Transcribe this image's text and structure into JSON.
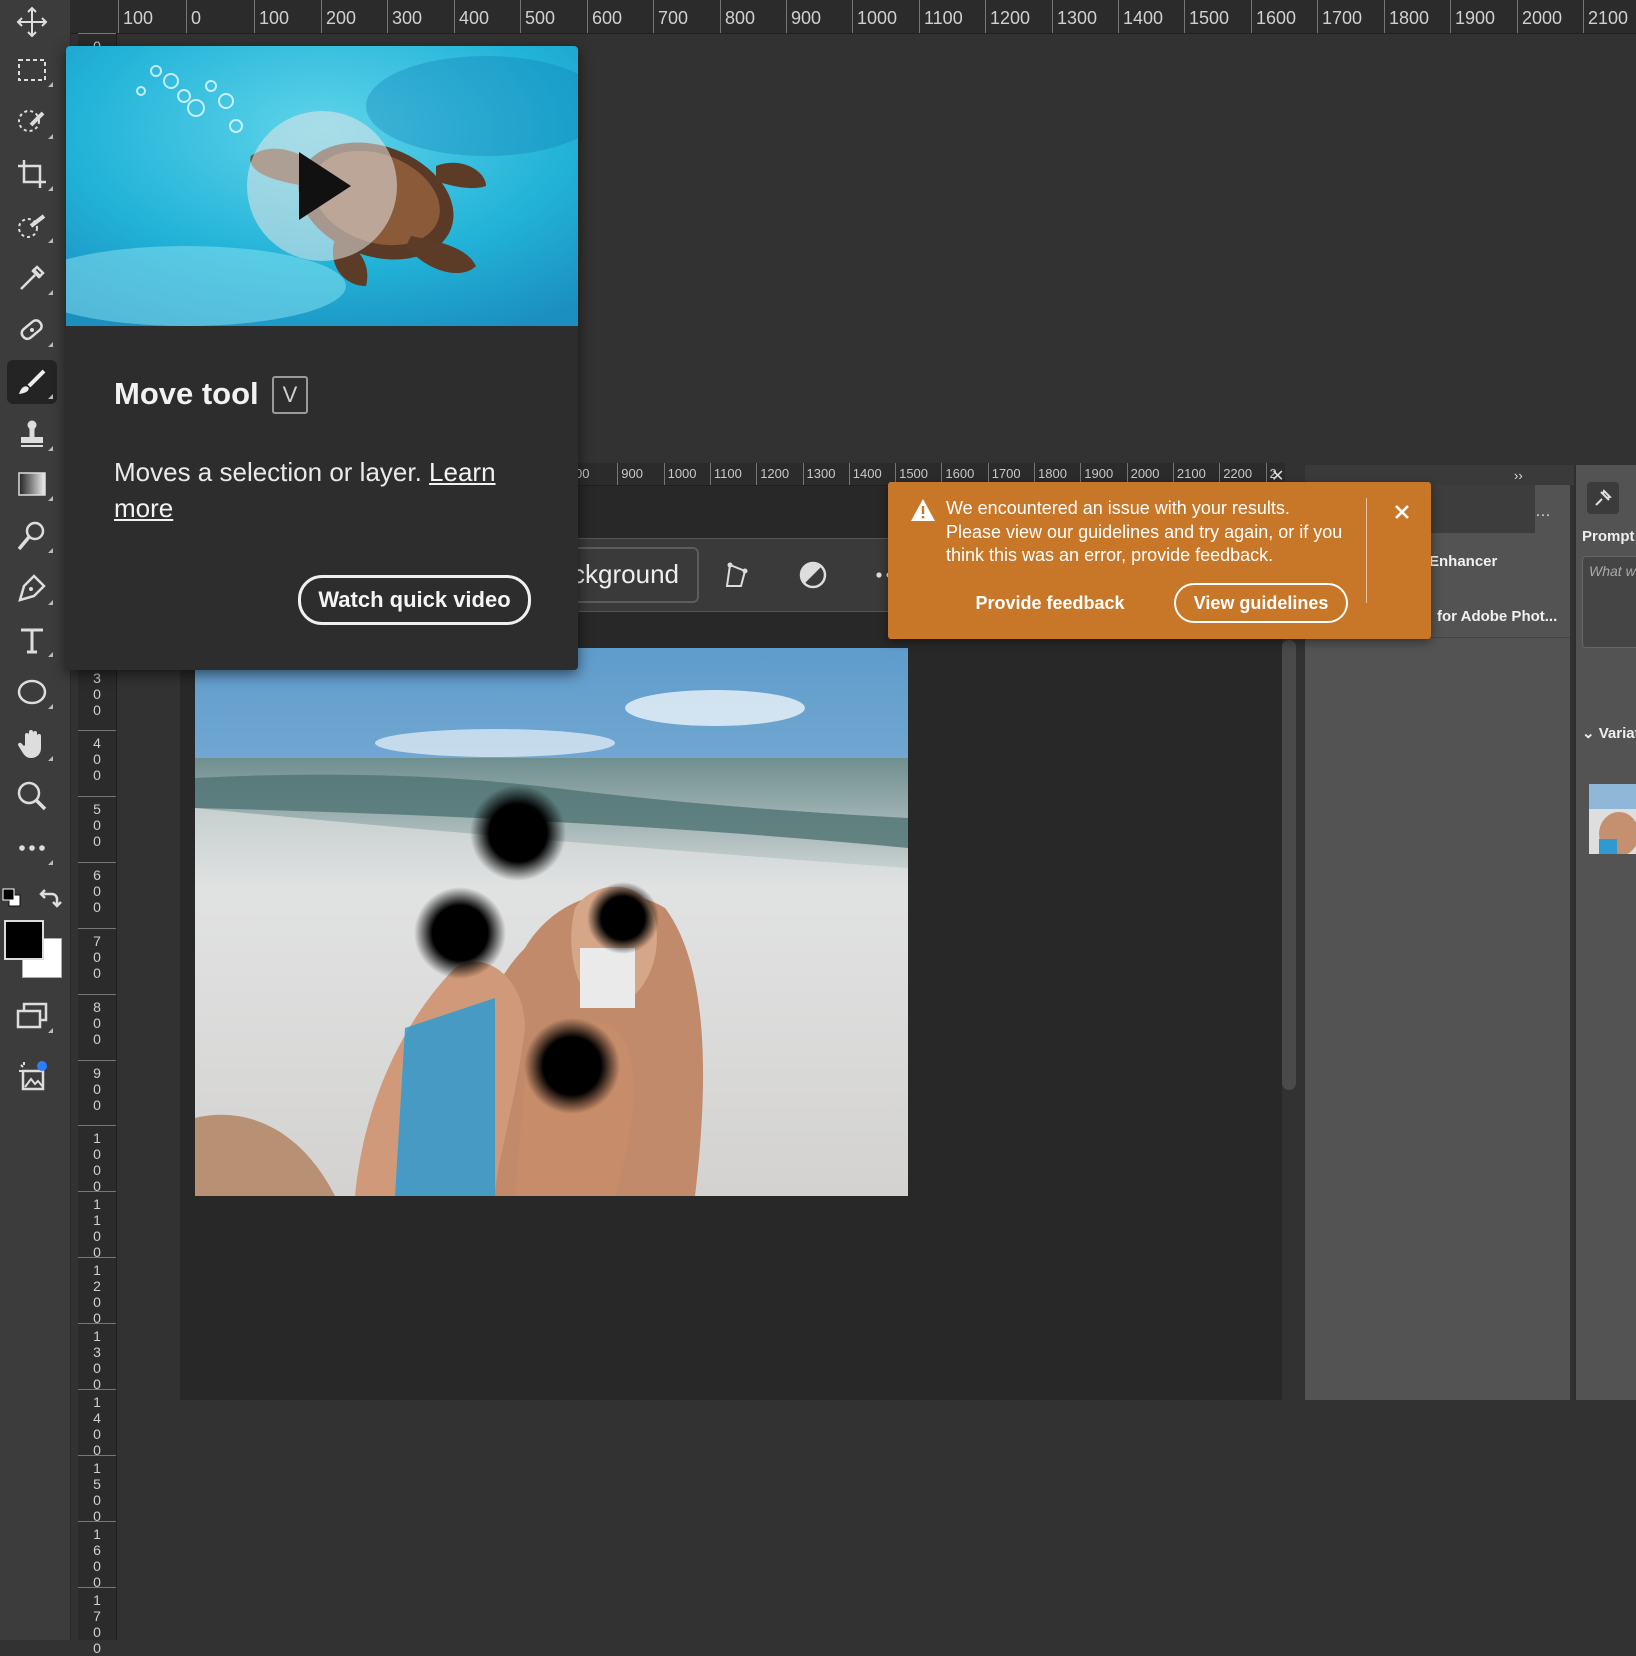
{
  "rulers": {
    "top": [
      "100",
      "0",
      "100",
      "200",
      "300",
      "400",
      "500",
      "600",
      "700",
      "800",
      "900",
      "1000",
      "1100",
      "1200",
      "1300",
      "1400",
      "1500",
      "1600",
      "1700",
      "1800",
      "1900",
      "2000",
      "2100"
    ],
    "left": [
      "0",
      "300",
      "400",
      "500",
      "600",
      "700",
      "800",
      "900",
      "1000",
      "1100",
      "1200",
      "1300",
      "1400",
      "1500",
      "1600",
      "1700"
    ],
    "document": [
      "00",
      "900",
      "1000",
      "1100",
      "1200",
      "1300",
      "1400",
      "1500",
      "1600",
      "1700",
      "1800",
      "1900",
      "2000",
      "2100",
      "2200",
      "2"
    ]
  },
  "toolbar": {
    "tools": [
      {
        "name": "move-tool",
        "icon": "move-icon",
        "active": false
      },
      {
        "name": "marquee-tool",
        "icon": "rectangle-marquee-icon",
        "active": false
      },
      {
        "name": "quick-selection-tool",
        "icon": "quick-selection-icon",
        "active": false
      },
      {
        "name": "crop-tool",
        "icon": "crop-icon",
        "active": false
      },
      {
        "name": "object-selection-tool",
        "icon": "object-selection-icon",
        "active": false
      },
      {
        "name": "eyedropper-tool",
        "icon": "eyedropper-icon",
        "active": false
      },
      {
        "name": "healing-brush-tool",
        "icon": "bandage-icon",
        "active": false
      },
      {
        "name": "brush-tool",
        "icon": "brush-icon",
        "active": true
      },
      {
        "name": "clone-stamp-tool",
        "icon": "stamp-icon",
        "active": false
      },
      {
        "name": "gradient-tool",
        "icon": "gradient-icon",
        "active": false
      },
      {
        "name": "dodge-tool",
        "icon": "dodge-icon",
        "active": false
      },
      {
        "name": "pen-tool",
        "icon": "pen-icon",
        "active": false
      },
      {
        "name": "type-tool",
        "icon": "type-icon",
        "active": false
      },
      {
        "name": "ellipse-tool",
        "icon": "ellipse-icon",
        "active": false
      },
      {
        "name": "hand-tool",
        "icon": "hand-icon",
        "active": false
      },
      {
        "name": "zoom-tool",
        "icon": "zoom-icon",
        "active": false
      },
      {
        "name": "more-tools",
        "icon": "more-icon",
        "active": false
      }
    ],
    "foreground_color": "#000000",
    "background_color": "#ffffff"
  },
  "tooltip": {
    "title": "Move tool",
    "shortcut": "V",
    "description": "Moves a selection or layer. ",
    "learn_more": "Learn more",
    "watch_button": "Watch quick video"
  },
  "taskbar": {
    "selection_label": "Remove background"
  },
  "toast": {
    "message": "We encountered an issue with your results. Please view our guidelines and try again, or if you think this was an error, provide feedback.",
    "feedback_button": "Provide feedback",
    "guidelines_button": "View guidelines"
  },
  "panel": {
    "item1": "Enhancer",
    "item2": "for Adobe Phot...",
    "prompt_label": "Prompt:",
    "prompt_placeholder": "What w",
    "variations_label": "Variat"
  },
  "colors": {
    "toast": "#c87627",
    "toolbar": "#3c3c3c",
    "canvas": "#323232"
  }
}
